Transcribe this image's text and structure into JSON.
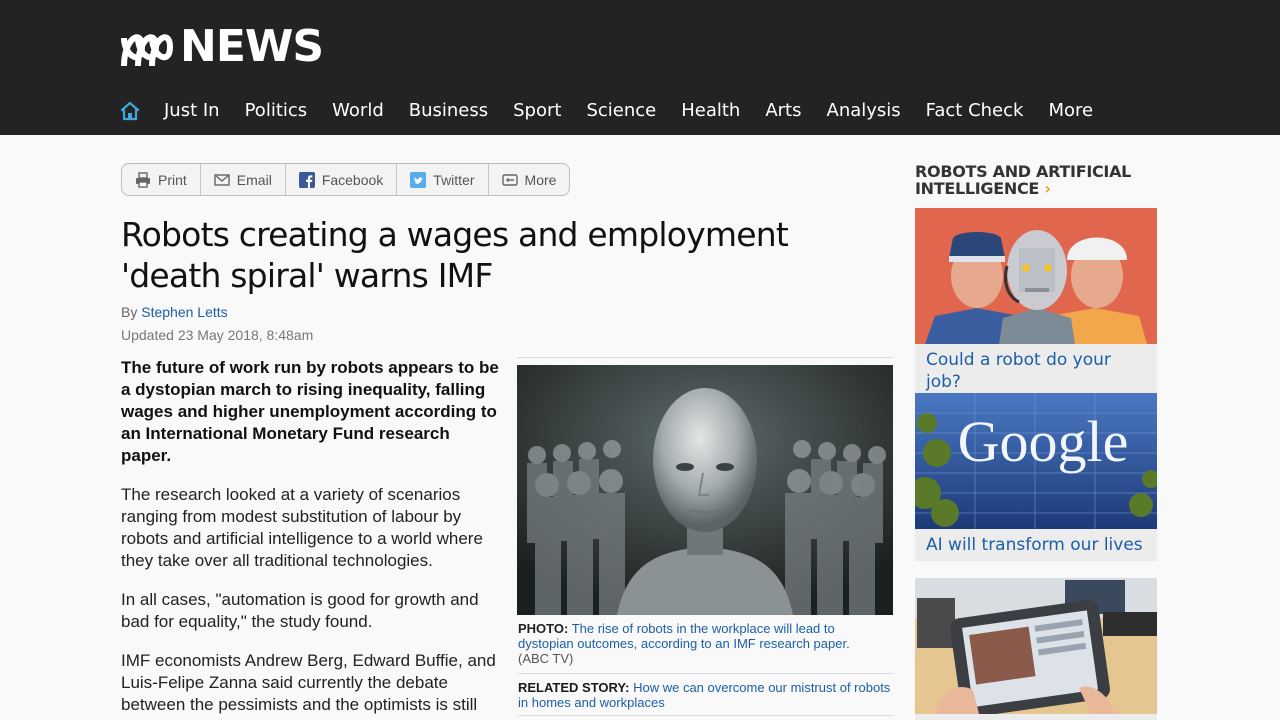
{
  "header": {
    "logo_text": "NEWS",
    "nav": [
      "Just In",
      "Politics",
      "World",
      "Business",
      "Sport",
      "Science",
      "Health",
      "Arts",
      "Analysis",
      "Fact Check",
      "More"
    ]
  },
  "share": {
    "print": "Print",
    "email": "Email",
    "facebook": "Facebook",
    "twitter": "Twitter",
    "more": "More"
  },
  "article": {
    "headline": "Robots creating a wages and employment 'death spiral' warns IMF",
    "by_prefix": "By",
    "author": "Stephen Letts",
    "updated": "Updated 23 May 2018, 8:48am",
    "lead": "The future of work run by robots appears to be a dystopian march to rising inequality, falling wages and higher unemployment according to an International Monetary Fund research paper.",
    "paragraphs": [
      "The research looked at a variety of scenarios ranging from modest substitution of labour by robots and artificial intelligence to a world where they take over all traditional technologies.",
      "In all cases, \"automation is good for growth and bad for equality,\" the study found.",
      "IMF economists Andrew Berg, Edward Buffie, and Luis-Felipe Zanna said currently the debate between the pessimists and the optimists is still unsettled."
    ],
    "photo_label": "PHOTO:",
    "photo_caption": "The rise of robots in the workplace will lead to dystopian outcomes, according to an IMF research paper.",
    "photo_credit": "(ABC TV)",
    "related_label": "RELATED STORY:",
    "related_link": "How we can overcome our mistrust of robots in homes and workplaces"
  },
  "sidebar": {
    "title": "ROBOTS AND ARTIFICIAL INTELLIGENCE",
    "chevron": "›",
    "cards": [
      {
        "label": "Could a robot do your job?"
      },
      {
        "label": "AI will transform our lives"
      },
      {
        "label": ""
      }
    ],
    "google_sign_text": "Google"
  },
  "colors": {
    "header_bg": "#232323",
    "link": "#1c5ea8",
    "home_icon": "#3fa7dc",
    "accent": "#e8a020"
  }
}
